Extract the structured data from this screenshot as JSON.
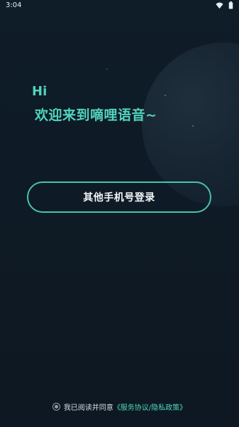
{
  "status_bar": {
    "time": "3:04",
    "icons": [
      "wifi-icon",
      "battery-icon"
    ]
  },
  "greeting": {
    "hi": "Hi",
    "welcome": "欢迎来到嘀哩语音~"
  },
  "login": {
    "button_label": "其他手机号登录"
  },
  "agreement": {
    "prefix": "我已阅读并同意",
    "link_text": "《服务协议/隐私政策》"
  },
  "colors": {
    "background": "#0f1b26",
    "accent": "#52d4bd",
    "button_border": "#45c4af",
    "text_primary": "#f2f5f7"
  }
}
